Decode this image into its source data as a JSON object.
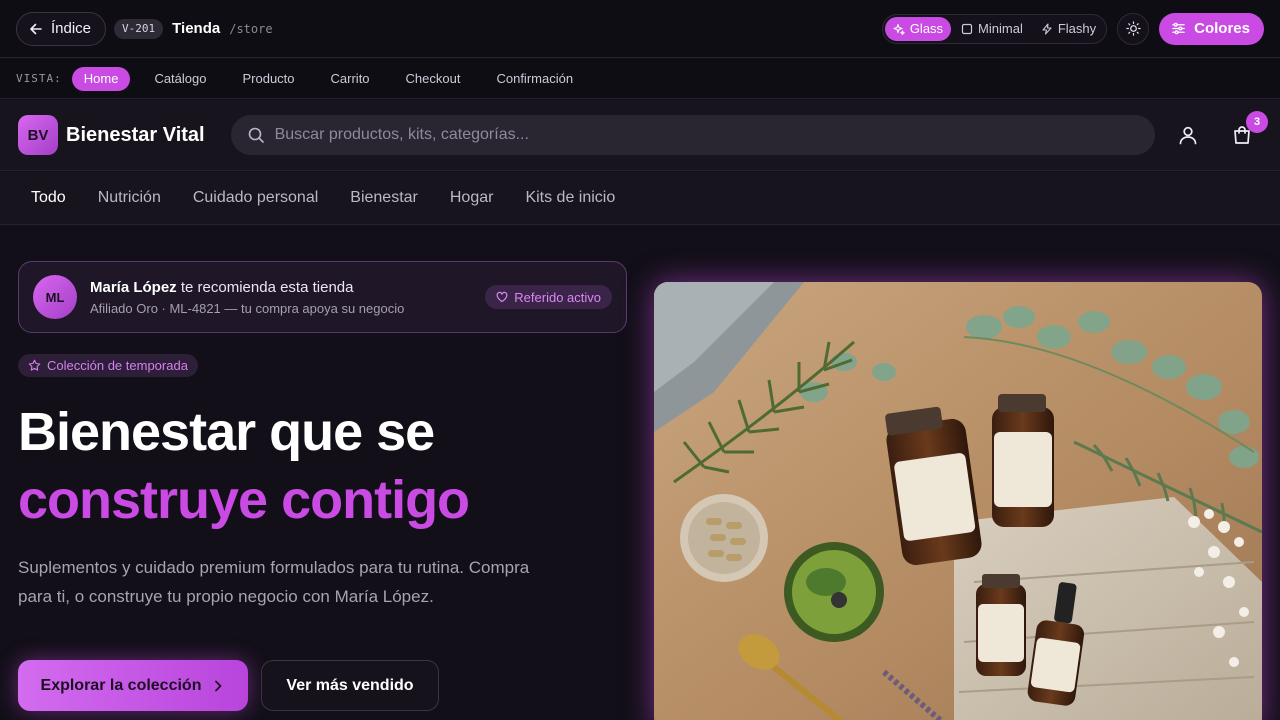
{
  "topbar": {
    "back_label": "Índice",
    "version": "V-201",
    "title": "Tienda",
    "path": "/store",
    "modes": [
      {
        "label": "Glass",
        "icon": "sparkles-icon",
        "active": true
      },
      {
        "label": "Minimal",
        "icon": "square-icon",
        "active": false
      },
      {
        "label": "Flashy",
        "icon": "bolt-icon",
        "active": false
      }
    ],
    "theme_icon": "sun-icon",
    "colors_label": "Colores"
  },
  "viewbar": {
    "label": "VISTA:",
    "tabs": [
      "Home",
      "Catálogo",
      "Producto",
      "Carrito",
      "Checkout",
      "Confirmación"
    ],
    "active": "Home"
  },
  "store": {
    "logo": "BV",
    "brand": "Bienestar Vital",
    "search_placeholder": "Buscar productos, kits, categorías...",
    "cart_count": "3"
  },
  "categories": {
    "items": [
      "Todo",
      "Nutrición",
      "Cuidado personal",
      "Bienestar",
      "Hogar",
      "Kits de inicio"
    ],
    "active": "Todo"
  },
  "hero": {
    "referral": {
      "initials": "ML",
      "name": "María López",
      "recommend": " te recomienda esta tienda",
      "sub": "Afiliado Oro · ML-4821 — tu compra apoya su negocio",
      "badge": "Referido activo"
    },
    "season_chip": "Colección de temporada",
    "title_line1": "Bienestar que se",
    "title_line2": "construye contigo",
    "description": "Suplementos y cuidado premium formulados para tu rutina. Compra para ti, o construye tu propio negocio con María López.",
    "primary_cta": "Explorar la colección",
    "secondary_cta": "Ver más vendido"
  },
  "colors": {
    "accent": "#c94be3",
    "background": "#120f18"
  }
}
